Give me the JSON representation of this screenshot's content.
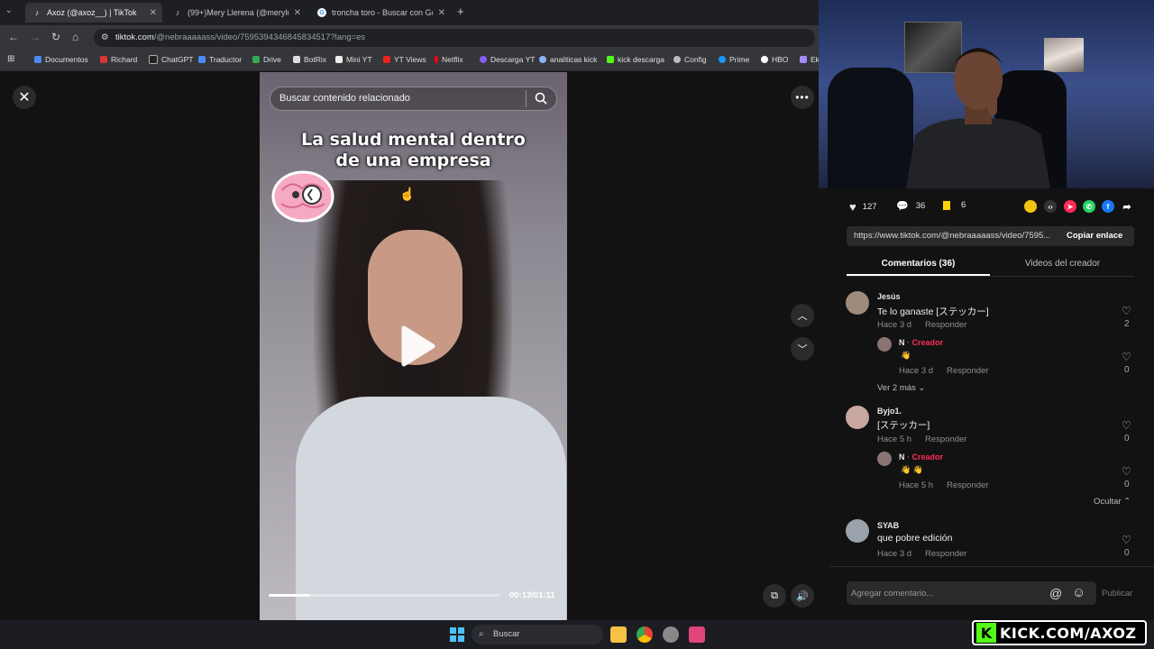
{
  "browser": {
    "tabs": [
      {
        "label": "Axoz (@axoz__) | TikTok",
        "active": true
      },
      {
        "label": "(99+)Mery Llerena (@merylu10",
        "active": false
      },
      {
        "label": "troncha toro - Buscar con Goo",
        "active": false
      }
    ],
    "new_tab": "+",
    "url_host": "tiktok.com",
    "url_path": "/@nebraaaaass/video/7595394346845834517?lang=es",
    "bookmarks": [
      "Documentos",
      "Richard",
      "ChatGPT",
      "Traductor",
      "Drive",
      "BotRix",
      "Mini YT",
      "YT Views",
      "Netflix",
      "Descarga YT",
      "analiticas kick",
      "kick descarga",
      "Config",
      "Prime",
      "HBO",
      "Ek"
    ]
  },
  "video": {
    "search_placeholder": "Buscar contenido relacionado",
    "caption_line1": "La salud mental dentro",
    "caption_line2": "de una empresa",
    "time": "00:13/01:11",
    "progress": 0.18
  },
  "stats": {
    "likes": "127",
    "comments": "36",
    "saves": "6"
  },
  "share_link": {
    "url": "https://www.tiktok.com/@nebraaaaass/video/7595...",
    "copy_label": "Copiar enlace"
  },
  "panel_tabs": {
    "comments": "Comentarios (36)",
    "videos": "Videos del creador"
  },
  "comments": [
    {
      "user": "Jesús",
      "text": "Te lo ganaste [ステッカー]",
      "time": "Hace 3 d",
      "reply": "Responder",
      "likes": "2"
    },
    {
      "user": "N",
      "badge": "· Creador",
      "time": "Hace 3 d",
      "reply": "Responder",
      "likes": "0"
    },
    {
      "more": "Ver 2 más"
    },
    {
      "user": "Byjo1.",
      "text": "[ステッカー]",
      "time": "Hace 5 h",
      "reply": "Responder",
      "likes": "0"
    },
    {
      "user": "N",
      "badge": "· Creador",
      "time": "Hace 5 h",
      "reply": "Responder",
      "likes": "0"
    },
    {
      "hide": "Ocultar"
    },
    {
      "user": "SYAB",
      "text": "que pobre edición",
      "time": "Hace 3 d",
      "reply": "Responder",
      "likes": "0"
    }
  ],
  "input": {
    "placeholder": "Agregar comentario...",
    "post": "Publicar"
  },
  "taskbar": {
    "search": "Buscar"
  },
  "overlay": {
    "kick": "KICK.COM/AXOZ"
  },
  "colors": {
    "accent": "#fe2c55",
    "kick": "#53fc18"
  }
}
